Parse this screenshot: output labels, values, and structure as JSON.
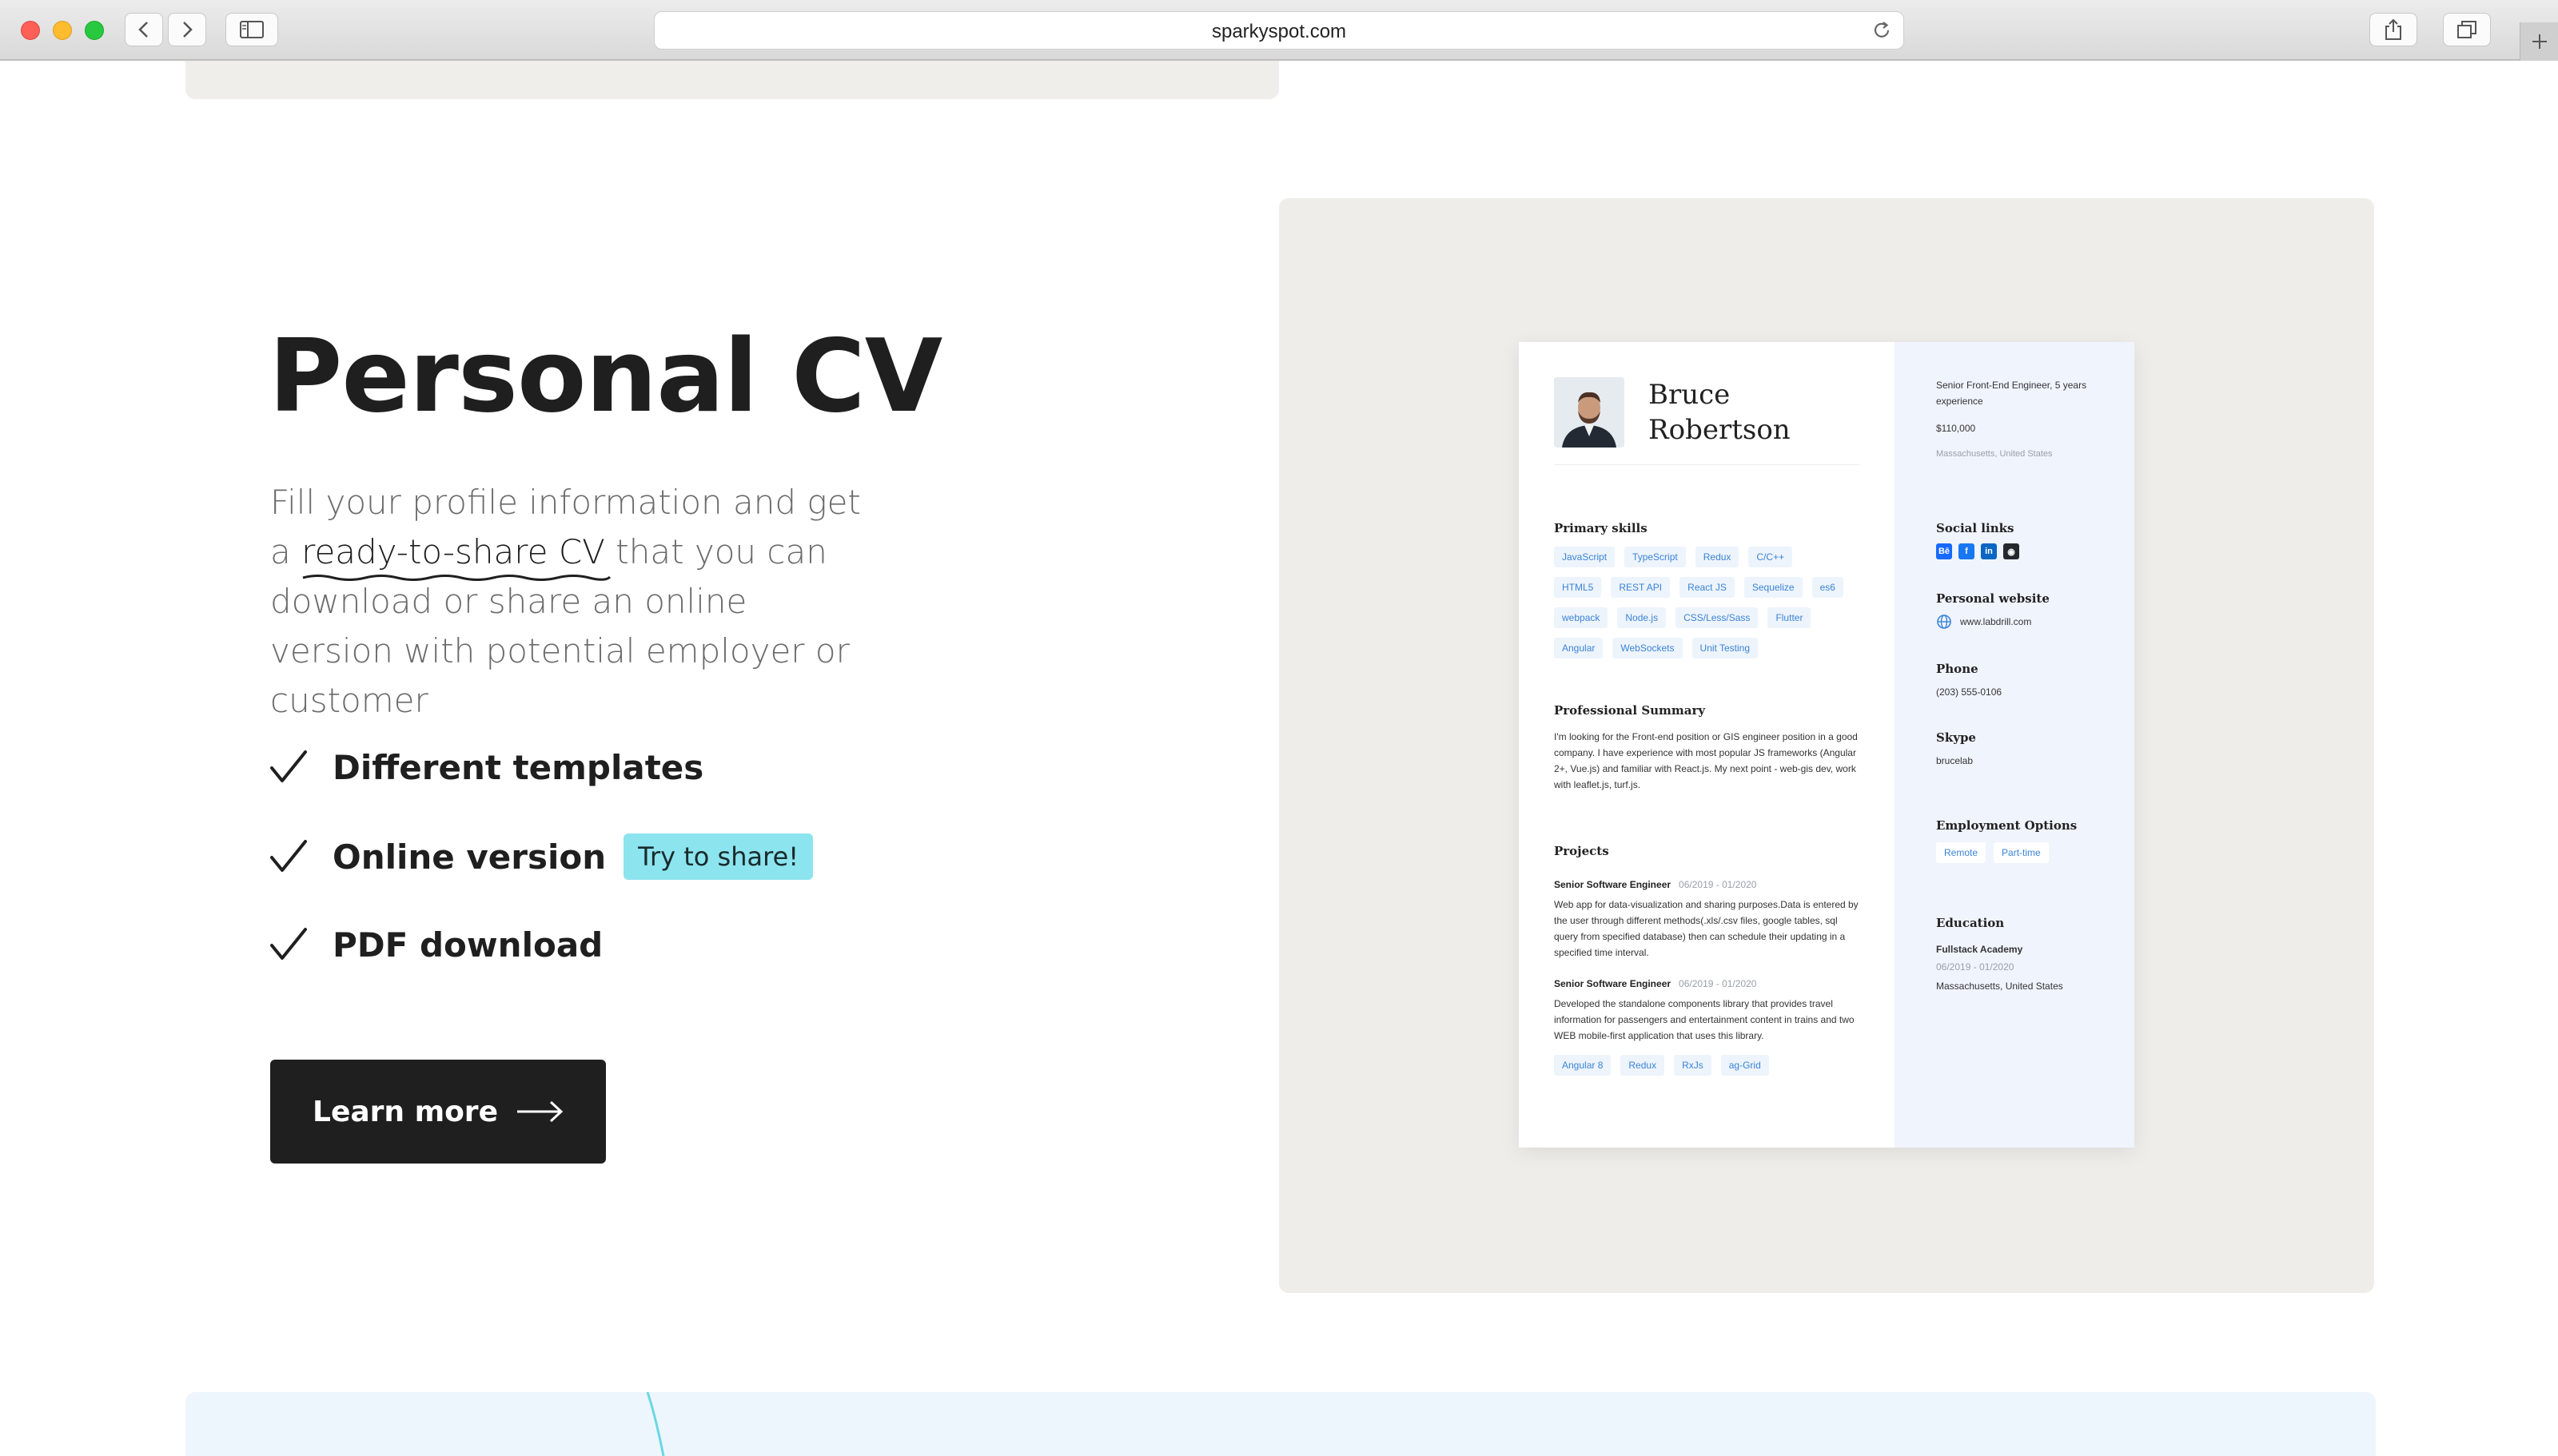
{
  "browser": {
    "url": "sparkyspot.com"
  },
  "hero": {
    "title": "Personal CV",
    "desc_part1": "Fill your profile information and get a ",
    "desc_highlight": "ready-to-share CV",
    "desc_part2": " that you can download or share an online version with potential employer or customer",
    "features": [
      {
        "label": "Different templates"
      },
      {
        "label": "Online version",
        "badge": "Try to share!"
      },
      {
        "label": "PDF download"
      }
    ],
    "cta_label": "Learn more"
  },
  "cv": {
    "name_first": "Bruce",
    "name_last": "Robertson",
    "primary_skills_title": "Primary skills",
    "skills": [
      "JavaScript",
      "TypeScript",
      "Redux",
      "C/C++",
      "HTML5",
      "REST API",
      "React JS",
      "Sequelize",
      "es6",
      "webpack",
      "Node.js",
      "CSS/Less/Sass",
      "Flutter",
      "Angular",
      "WebSockets",
      "Unit Testing"
    ],
    "summary_title": "Professional Summary",
    "summary_text": "I'm looking for the Front-end position or GIS engineer position in a good company. I have experience with most popular JS frameworks (Angular 2+, Vue.js) and familiar with React.js. My next point - web-gis dev, work with leaflet.js, turf.js.",
    "projects_title": "Projects",
    "projects": [
      {
        "title": "Senior Software Engineer",
        "date": "06/2019 - 01/2020",
        "text": "Web app for data-visualization and sharing purposes.Data is entered by the user through different methods(.xls/.csv files, google tables, sql query from specified database) then can schedule their updating in a specified time interval."
      },
      {
        "title": "Senior Software Engineer",
        "date": "06/2019 - 01/2020",
        "text": "Developed the standalone components library that provides travel information for passengers and entertainment content in trains and two WEB mobile-first application that uses this library.",
        "tags": [
          "Angular 8",
          "Redux",
          "RxJs",
          "ag-Grid"
        ]
      }
    ],
    "position": "Senior Front-End Engineer, 5 years experience",
    "salary": "$110,000",
    "location": "Massachusetts, United States",
    "social_title": "Social links",
    "social_icons": [
      {
        "name": "behance-icon",
        "glyph": "Bē",
        "color": "#1769ff"
      },
      {
        "name": "facebook-icon",
        "glyph": "f",
        "color": "#1877f2"
      },
      {
        "name": "linkedin-icon",
        "glyph": "in",
        "color": "#0a66c2"
      },
      {
        "name": "github-icon",
        "glyph": "◉",
        "color": "#24292e"
      }
    ],
    "website_title": "Personal website",
    "website": "www.labdrill.com",
    "phone_title": "Phone",
    "phone": "(203) 555-0106",
    "skype_title": "Skype",
    "skype": "brucelab",
    "employment_title": "Employment Options",
    "employment": [
      "Remote",
      "Part-time"
    ],
    "education_title": "Education",
    "education_school": "Fullstack Academy",
    "education_date": "06/2019 - 01/2020",
    "education_location": "Massachusetts, United States"
  }
}
